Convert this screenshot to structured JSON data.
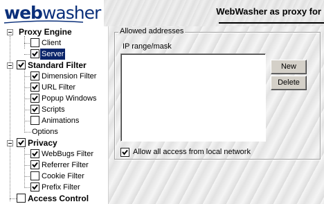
{
  "header": {
    "logo_web": "web",
    "logo_washer": "washer",
    "title": "WebWasher as proxy for"
  },
  "tree": {
    "proxy_engine": {
      "label": "Proxy Engine",
      "children": [
        {
          "label": "Client",
          "checked": false,
          "selected": false
        },
        {
          "label": "Server",
          "checked": true,
          "selected": true
        }
      ]
    },
    "standard_filter": {
      "label": "Standard Filter",
      "checked": true,
      "children": [
        {
          "label": "Dimension Filter",
          "checked": true
        },
        {
          "label": "URL Filter",
          "checked": true
        },
        {
          "label": "Popup Windows",
          "checked": true
        },
        {
          "label": "Scripts",
          "checked": true
        },
        {
          "label": "Animations",
          "checked": false
        },
        {
          "label": "Options"
        }
      ]
    },
    "privacy": {
      "label": "Privacy",
      "checked": true,
      "children": [
        {
          "label": "WebBugs Filter",
          "checked": true
        },
        {
          "label": "Referrer Filter",
          "checked": true
        },
        {
          "label": "Cookie Filter",
          "checked": false
        },
        {
          "label": "Prefix Filter",
          "checked": true
        }
      ]
    },
    "access_control": {
      "label": "Access Control",
      "checked": false
    }
  },
  "panel": {
    "group_title": "Allowed addresses",
    "ip_label": "IP range/mask",
    "ip_entries": [],
    "new_button": "New",
    "delete_button": "Delete",
    "allow_local_label": "Allow all access from local network",
    "allow_local_checked": true
  },
  "colors": {
    "selection": "#0a246a",
    "logo": "#0a2f7a",
    "button_face": "#d4d0c8"
  }
}
